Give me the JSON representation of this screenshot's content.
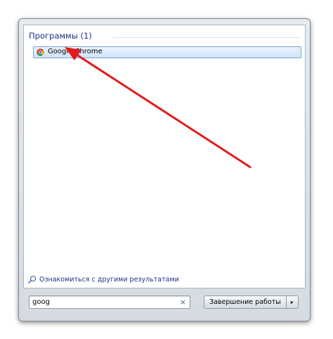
{
  "search_results": {
    "group_title": "Программы (1)",
    "items": [
      {
        "label": "Google Chrome",
        "icon": "chrome-icon"
      }
    ]
  },
  "more_results": {
    "label": "Ознакомиться с другими результатами",
    "icon": "search-icon"
  },
  "search": {
    "value": "goog",
    "clear_glyph": "×"
  },
  "shutdown": {
    "label": "Завершение работы",
    "arrow_glyph": "▸"
  },
  "colors": {
    "header_text": "#1e3287",
    "highlight": "#cfe3fb",
    "annotation_arrow": "#e21b1b"
  }
}
